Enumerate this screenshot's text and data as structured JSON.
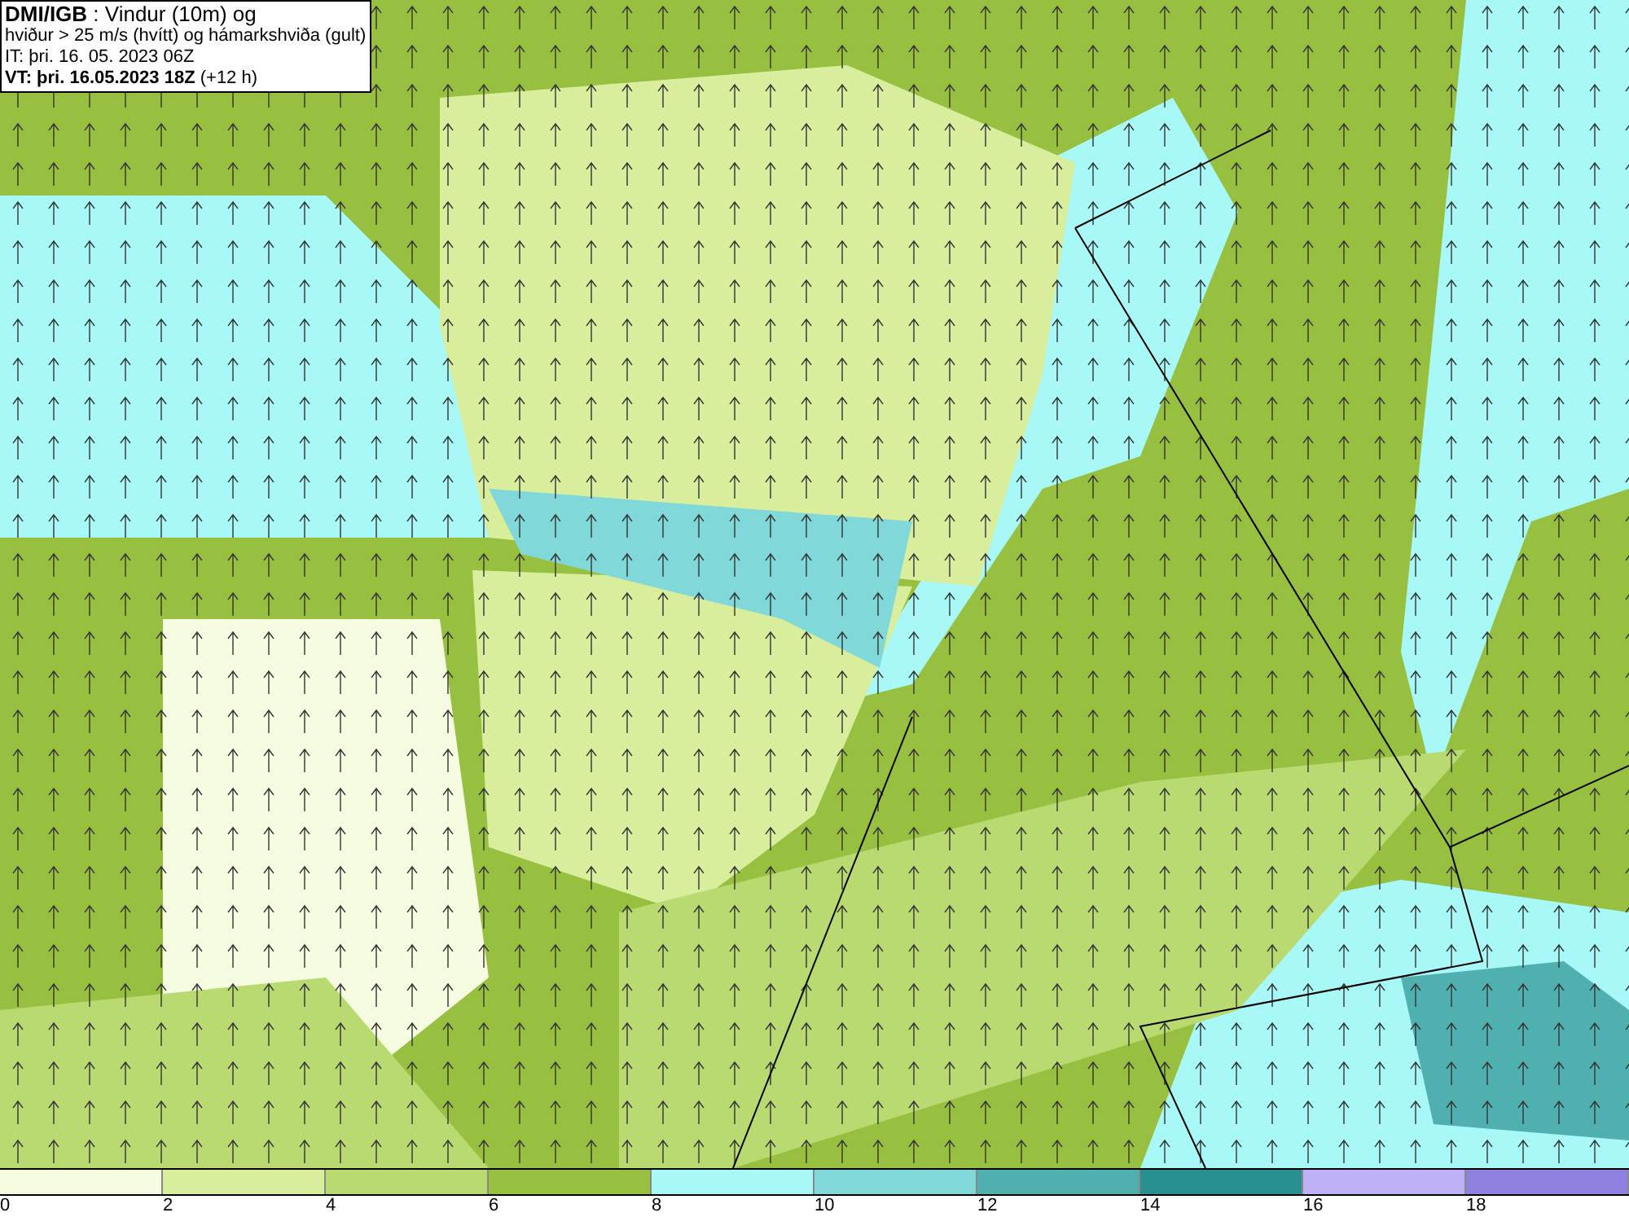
{
  "header": {
    "lines": [
      "**DMI/IGB** : Vindur (10m) og",
      "hviður > 25 m/s (hvítt) og hámarkshviða (gult)",
      "IT: þri. 16. 05. 2023 06Z",
      "**VT: þri. 16.05.2023 18Z** (+12 h)"
    ]
  },
  "colorbar": {
    "bins": [
      {
        "color": "#f5fce0"
      },
      {
        "color": "#d8ee9c"
      },
      {
        "color": "#b8da70"
      },
      {
        "color": "#98c040"
      },
      {
        "color": "#a8f8f8"
      },
      {
        "color": "#80d8d8"
      },
      {
        "color": "#50b0b0"
      },
      {
        "color": "#289090"
      },
      {
        "color": "#c0b0f8"
      },
      {
        "color": "#9080e0"
      }
    ],
    "ticks": [
      "0",
      "2",
      "4",
      "6",
      "8",
      "10",
      "12",
      "14",
      "16",
      "18"
    ]
  }
}
